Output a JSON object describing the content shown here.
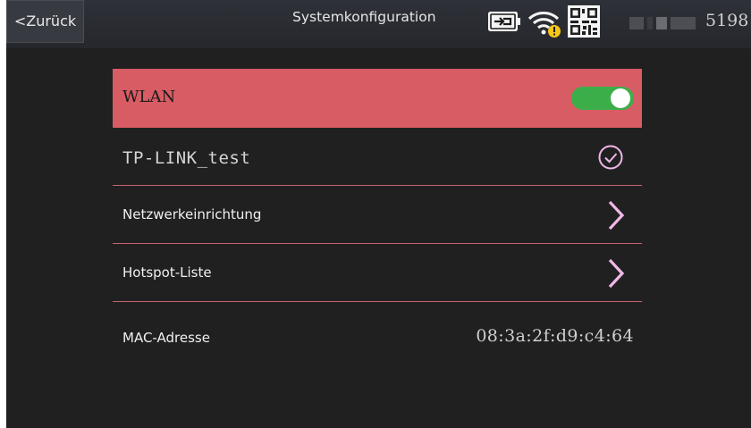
{
  "header": {
    "back_label": "<Zurück",
    "title": "Systemkonfiguration",
    "serial_suffix": "5198",
    "icons": [
      "battery-charging-icon",
      "wifi-warning-icon",
      "qr-code-icon"
    ]
  },
  "wifi": {
    "toggle_label": "WLAN",
    "toggle_on": true,
    "connected_ssid": "TP-LINK_test",
    "network_setup_label": "Netzwerkeinrichtung",
    "hotspot_list_label": "Hotspot-Liste",
    "mac_label": "MAC-Adresse",
    "mac_value": "08:3a:2f:d9:c4:64"
  },
  "colors": {
    "accent": "#d75c64",
    "toggle_on": "#3cae49",
    "icon_pink": "#f0b8e8",
    "warning": "#f5c518",
    "background": "#202020"
  }
}
